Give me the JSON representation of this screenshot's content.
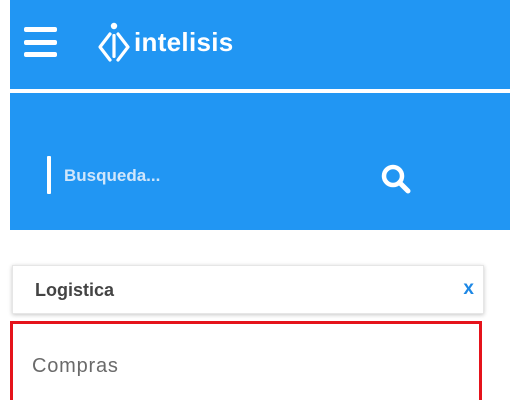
{
  "header": {
    "brand": "intelisis",
    "background_color": "#2196f3",
    "icons": {
      "menu": "hamburger-menu-icon",
      "logo": "intelisis-logo-icon"
    }
  },
  "search": {
    "placeholder": "Busqueda...",
    "value": "",
    "icon": "search-icon"
  },
  "section_card": {
    "title": "Logistica",
    "close_label": "x",
    "close_color": "#1e88e5"
  },
  "menu_items": [
    {
      "label": "Compras",
      "highlighted": true,
      "highlight_color": "#e5131b"
    }
  ]
}
